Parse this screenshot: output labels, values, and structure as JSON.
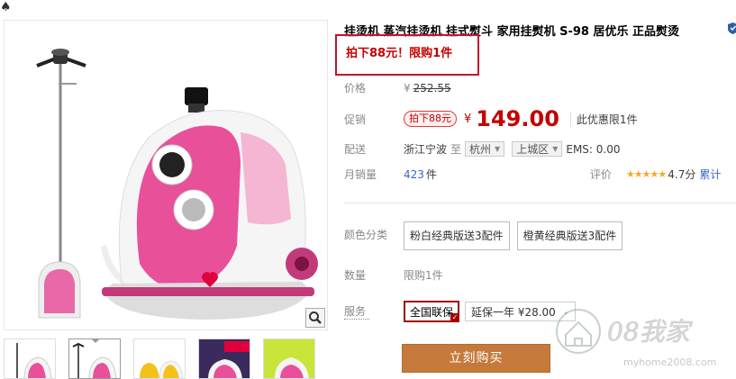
{
  "product": {
    "title": "挂烫机 蒸汽挂烫机 挂式熨斗 家用挂熨机 S-98 居优乐 正品熨烫",
    "promo_banner": "拍下88元！限购1件"
  },
  "price": {
    "label": "价格",
    "currency": "¥",
    "original": "252.55"
  },
  "promotion": {
    "label": "促销",
    "tag": "拍下88元",
    "currency": "¥",
    "price": "149.00",
    "limit_note": "此优惠限1件"
  },
  "delivery": {
    "label": "配送",
    "from": "浙江宁波",
    "to_word": "至",
    "city": "杭州",
    "district": "上城区",
    "shipping": "EMS: 0.00"
  },
  "sales": {
    "label": "月销量",
    "count": "423",
    "unit": "件",
    "review_label": "评价",
    "stars": "★★★★★",
    "rating": "4.7分",
    "cumulative": "累计"
  },
  "color": {
    "label": "颜色分类",
    "options": [
      "粉白经典版送3配件",
      "橙黄经典版送3配件"
    ]
  },
  "quantity": {
    "label": "数量",
    "value": "限购1件"
  },
  "service": {
    "label": "服务",
    "selected": "全国联保",
    "extend": "延保一年 ¥28.00"
  },
  "buy_button": "立刻购买",
  "watermark": {
    "brand": "08我家",
    "url": "myhome2008.com"
  },
  "colors": {
    "accent_red": "#c40000",
    "buy_button": "#c57a3b",
    "link_blue": "#3366cc",
    "product_pink": "#e8509a"
  }
}
